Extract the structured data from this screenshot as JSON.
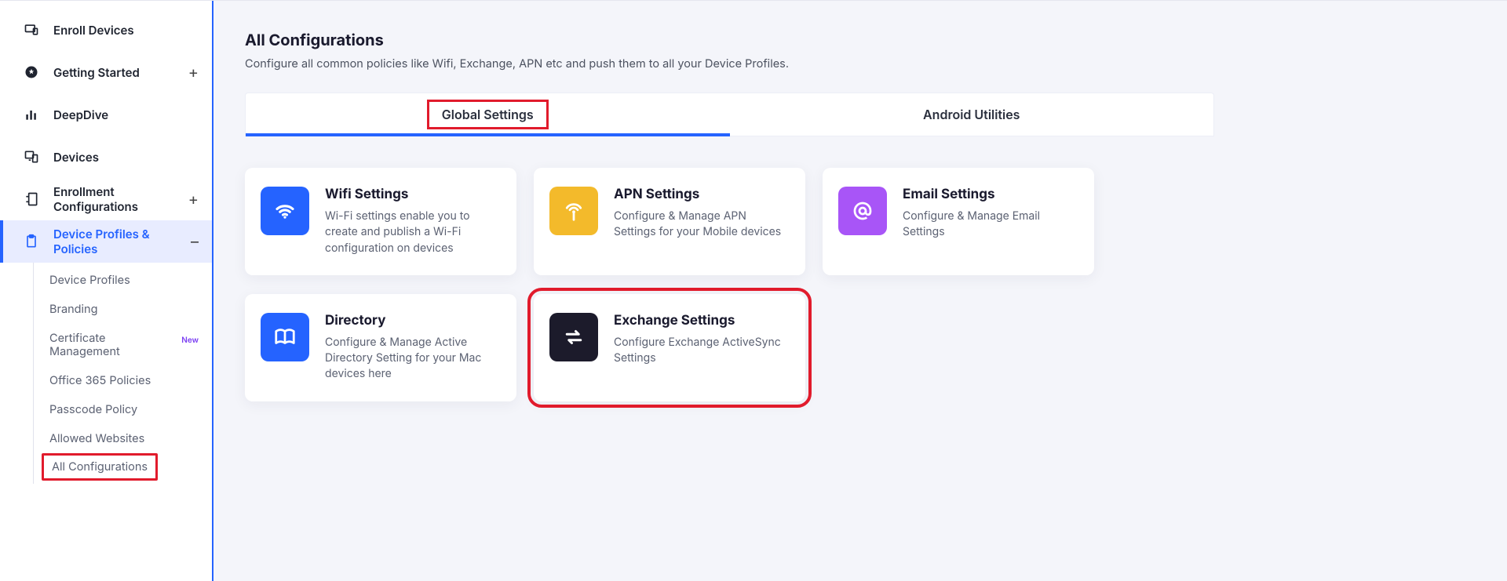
{
  "sidebar": {
    "items": [
      {
        "label": "Enroll Devices",
        "trailing": ""
      },
      {
        "label": "Getting Started",
        "trailing": "+"
      },
      {
        "label": "DeepDive",
        "trailing": ""
      },
      {
        "label": "Devices",
        "trailing": ""
      },
      {
        "label": "Enrollment Configurations",
        "trailing": "+"
      },
      {
        "label": "Device Profiles & Policies",
        "trailing": "–"
      }
    ],
    "sub_items": [
      {
        "label": "Device Profiles"
      },
      {
        "label": "Branding"
      },
      {
        "label": "Certificate Management",
        "badge": "New"
      },
      {
        "label": "Office 365 Policies"
      },
      {
        "label": "Passcode Policy"
      },
      {
        "label": "Allowed Websites"
      },
      {
        "label": "All Configurations"
      }
    ]
  },
  "page": {
    "title": "All Configurations",
    "subtitle": "Configure all common policies like Wifi, Exchange, APN etc and push them to all your Device Profiles."
  },
  "tabs": {
    "global": "Global Settings",
    "android": "Android Utilities"
  },
  "cards": {
    "wifi": {
      "title": "Wifi Settings",
      "desc": "Wi-Fi settings enable you to create and publish a Wi-Fi configuration on devices"
    },
    "apn": {
      "title": "APN Settings",
      "desc": "Configure & Manage APN Settings for your Mobile devices"
    },
    "email": {
      "title": "Email Settings",
      "desc": "Configure & Manage Email Settings"
    },
    "directory": {
      "title": "Directory",
      "desc": "Configure & Manage Active Directory Setting for your Mac devices here"
    },
    "exchange": {
      "title": "Exchange Settings",
      "desc": "Configure Exchange ActiveSync Settings"
    }
  }
}
